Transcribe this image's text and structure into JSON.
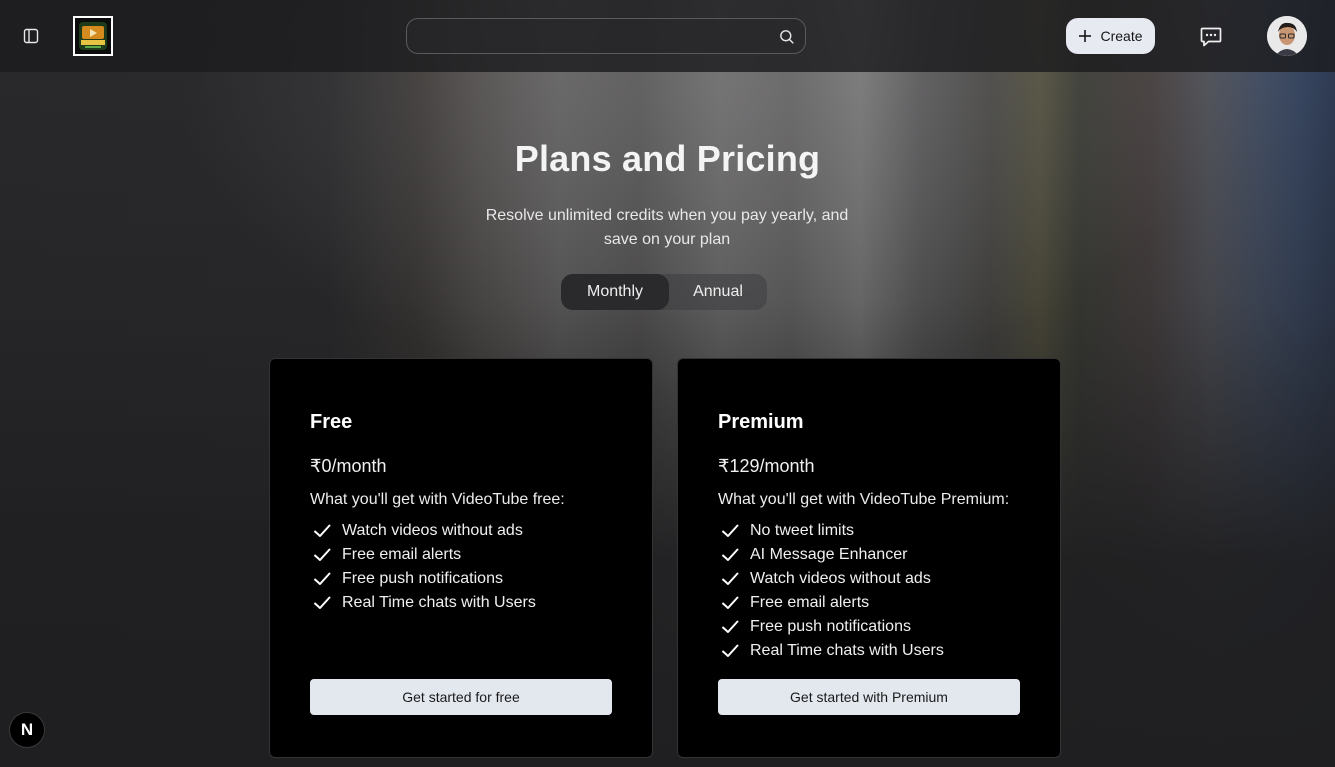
{
  "header": {
    "logo_text": "VIDEOTUBE",
    "search": {
      "placeholder": "",
      "value": ""
    },
    "create_label": "Create"
  },
  "hero": {
    "title": "Plans and Pricing",
    "subtitle_line1": "Resolve unlimited credits when you pay yearly, and",
    "subtitle_line2": "save on your plan",
    "toggle": [
      {
        "label": "Monthly",
        "active": true
      },
      {
        "label": "Annual",
        "active": false
      }
    ]
  },
  "plans": [
    {
      "name": "Free",
      "price": "₹0/month",
      "intro": "What you'll get with VideoTube free:",
      "features": [
        "Watch videos without ads",
        "Free email alerts",
        "Free push notifications",
        "Real Time chats with Users"
      ],
      "cta": "Get started for free"
    },
    {
      "name": "Premium",
      "price": "₹129/month",
      "intro": "What you'll get with VideoTube Premium:",
      "features": [
        "No tweet limits",
        "AI Message Enhancer",
        "Watch videos without ads",
        "Free email alerts",
        "Free push notifications",
        "Real Time chats with Users"
      ],
      "cta": "Get started with Premium"
    }
  ],
  "badge": {
    "letter": "N"
  },
  "colors": {
    "button_bg": "#e3e8ef",
    "card_bg": "#000000",
    "header_bg": "#1c1c1e"
  },
  "icons": [
    "sidebar-toggle-icon",
    "search-icon",
    "plus-icon",
    "chat-icon",
    "check-icon"
  ]
}
